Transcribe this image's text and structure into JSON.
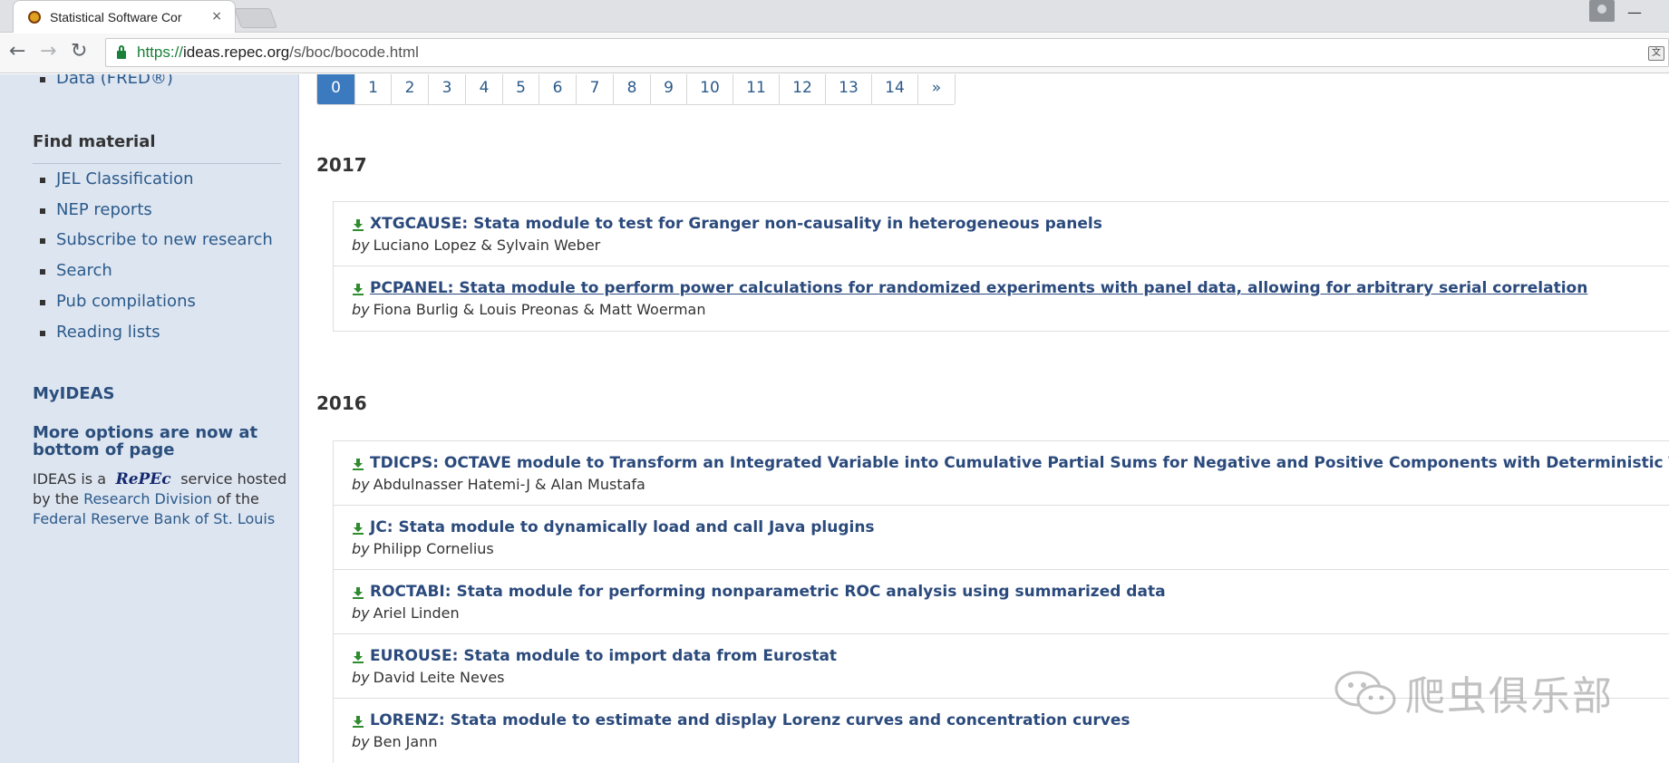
{
  "browser": {
    "tab_title": "Statistical Software Cor",
    "tab_close": "×",
    "url_scheme": "https://",
    "url_host": "ideas.repec.org",
    "url_path": "/s/boc/bocode.html",
    "nav_back": "←",
    "nav_forward": "→",
    "nav_reload": "↻",
    "win_minimize": "—",
    "win_maximize": "□",
    "translate_glyph": "文"
  },
  "sidebar": {
    "top_item": "Data (FRED®)",
    "find_material_heading": "Find material",
    "find_material_items": [
      "JEL Classification",
      "NEP reports",
      "Subscribe to new research",
      "Search",
      "Pub compilations",
      "Reading lists"
    ],
    "myideas": "MyIDEAS",
    "more_options": "More options are now at bottom of page",
    "ideas_is_a": "IDEAS is a",
    "repec_logo": "RePEc",
    "service_hosted_by": "service hosted by the",
    "research_division": "Research Division",
    "of_the": "of the",
    "fed_bank": "Federal Reserve Bank of St. Louis"
  },
  "pagination": [
    "0",
    "1",
    "2",
    "3",
    "4",
    "5",
    "6",
    "7",
    "8",
    "9",
    "10",
    "11",
    "12",
    "13",
    "14",
    "»"
  ],
  "pagination_active": "0",
  "by_label": "by",
  "years": [
    {
      "year": "2017",
      "entries": [
        {
          "title": "XTGCAUSE: Stata module to test for Granger non-causality in heterogeneous panels",
          "authors": "Luciano Lopez & Sylvain Weber"
        },
        {
          "title": "PCPANEL: Stata module to perform power calculations for randomized experiments with panel data, allowing for arbitrary serial correlation",
          "authors": "Fiona Burlig & Louis Preonas & Matt Woerman"
        }
      ]
    },
    {
      "year": "2016",
      "entries": [
        {
          "title": "TDICPS: OCTAVE module to Transform an Integrated Variable into Cumulative Partial Sums for Negative and Positive Components with Deterministic Trend Parts",
          "authors": "Abdulnasser Hatemi-J & Alan Mustafa"
        },
        {
          "title": "JC: Stata module to dynamically load and call Java plugins",
          "authors": "Philipp Cornelius"
        },
        {
          "title": "ROCTABI: Stata module for performing nonparametric ROC analysis using summarized data",
          "authors": "Ariel Linden"
        },
        {
          "title": "EUROUSE: Stata module to import data from Eurostat",
          "authors": "David Leite Neves"
        },
        {
          "title": "LORENZ: Stata module to estimate and display Lorenz curves and concentration curves",
          "authors": "Ben Jann"
        }
      ]
    }
  ],
  "watermark": "爬虫俱乐部",
  "colors": {
    "sidebar_bg": "#dde5f1",
    "link": "#2b4a7c",
    "active_page": "#3b7abf",
    "download_icon": "#2e8b2e"
  }
}
